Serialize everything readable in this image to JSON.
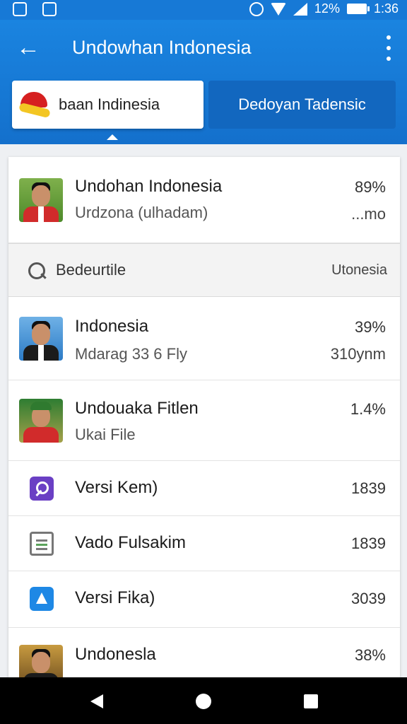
{
  "status_bar": {
    "battery_percent": "12%",
    "time": "1:36"
  },
  "app_bar": {
    "title": "Undowhan Indonesia",
    "back_icon": "arrow-left-icon",
    "menu_icon": "more-vert-icon"
  },
  "tabs": [
    {
      "label": "baan Indinesia",
      "active": true
    },
    {
      "label": "Dedoyan Tadensic",
      "active": false
    }
  ],
  "header_item": {
    "title": "Undohan Indonesia",
    "subtitle": "Urdzona (ulhadam)",
    "value": "89%",
    "value2": "...mo"
  },
  "search": {
    "label": "Bedeurtile",
    "right": "Utonesia"
  },
  "items": [
    {
      "title": "Indonesia",
      "subtitle": "Mdarag 33 6 Fly",
      "value": "39%",
      "value2": "310ynm",
      "icon": "avatar-man-icon"
    },
    {
      "title": "Undouaka Fitlen",
      "subtitle": "Ukai File",
      "value": "1.4%",
      "icon": "avatar-man-green-cap-icon"
    },
    {
      "title": "Versi Kem)",
      "value": "1839",
      "icon": "key-file-icon"
    },
    {
      "title": "Vado Fulsakim",
      "value": "1839",
      "icon": "document-icon"
    },
    {
      "title": "Versi Fika)",
      "value": "3039",
      "icon": "blue-file-icon"
    },
    {
      "title": "Undonesla",
      "value": "38%",
      "icon": "avatar-gold-icon"
    }
  ],
  "colors": {
    "primary": "#1779d6",
    "tab_inactive": "#1267bf"
  }
}
